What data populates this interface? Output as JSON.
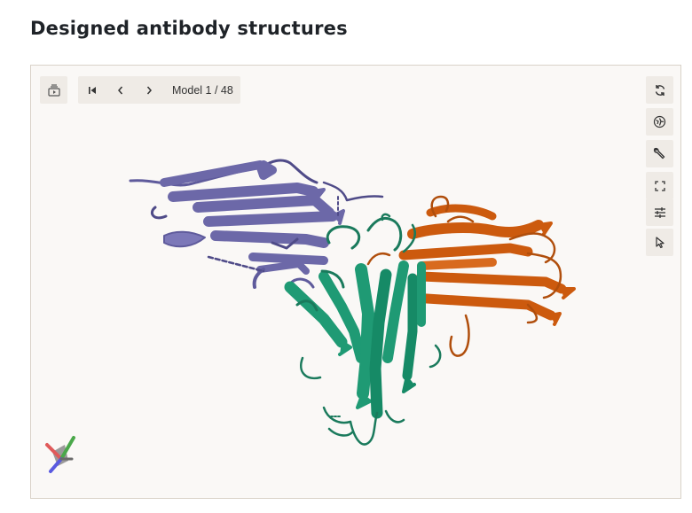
{
  "page": {
    "title": "Designed antibody structures"
  },
  "viewer": {
    "model": {
      "label": "Model 1 / 48",
      "current": 1,
      "total": 48
    },
    "left_tools": [
      "animation-icon"
    ],
    "nav_icons": [
      "first-model-icon",
      "previous-model-icon",
      "next-model-icon"
    ],
    "right_tools": [
      "reset-camera-icon",
      "screenshot-icon",
      "tools-icon",
      "fullscreen-icon",
      "settings-icon",
      "select-mode-icon"
    ],
    "chain_colors": {
      "chain_a": "#6c68a8",
      "chain_b": "#1a8a68",
      "chain_c": "#cc5a0e"
    },
    "background": "#faf8f6"
  }
}
